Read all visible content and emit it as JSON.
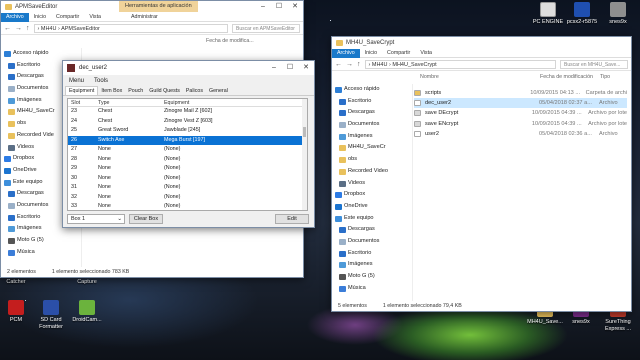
{
  "left_explorer": {
    "title": "APMSaveEditor",
    "context_tab": "Herramientas de aplicación",
    "manage_tab": "Administrar",
    "ribbon": [
      "Archivo",
      "Inicio",
      "Compartir",
      "Vista"
    ],
    "path": [
      "MH4U",
      "APMSaveEditor"
    ],
    "search_placeholder": "Buscar en APMSaveEditor",
    "date_header": "Fecha de modifica...",
    "nav": [
      {
        "label": "Acceso rápido",
        "icon": "star-icon",
        "group": true
      },
      {
        "label": "Escritorio",
        "icon": "desktop-icon"
      },
      {
        "label": "Descargas",
        "icon": "download-icon"
      },
      {
        "label": "Documentos",
        "icon": "documents-icon"
      },
      {
        "label": "Imágenes",
        "icon": "pictures-icon"
      },
      {
        "label": "MH4U_SaveCr",
        "icon": "folder-icon"
      },
      {
        "label": "obs",
        "icon": "folder-icon"
      },
      {
        "label": "Recorded Vide",
        "icon": "folder-icon"
      },
      {
        "label": "Videos",
        "icon": "videos-icon"
      },
      {
        "label": "Dropbox",
        "icon": "dropbox-icon",
        "group": true
      },
      {
        "label": "OneDrive",
        "icon": "onedrive-icon",
        "group": true
      },
      {
        "label": "Este equipo",
        "icon": "pc-icon",
        "group": true
      },
      {
        "label": "Descargas",
        "icon": "download-icon"
      },
      {
        "label": "Documentos",
        "icon": "documents-icon"
      },
      {
        "label": "Escritorio",
        "icon": "desktop-icon"
      },
      {
        "label": "Imágenes",
        "icon": "pictures-icon"
      },
      {
        "label": "Moto G (5)",
        "icon": "phone-icon"
      },
      {
        "label": "Música",
        "icon": "music-icon"
      }
    ],
    "status_count": "2 elementos",
    "status_selected": "1 elemento seleccionado  783 KB"
  },
  "dialog": {
    "title": "dec_user2",
    "menu": [
      "Menu",
      "Tools"
    ],
    "tabs": [
      "Equipment",
      "Item Box",
      "Pouch",
      "Guild Quests",
      "Palicos",
      "General"
    ],
    "active_tab": "Equipment",
    "columns": [
      "Slot",
      "Type",
      "Equipment"
    ],
    "rows": [
      [
        "23",
        "Chest",
        "Zinogre Mail Z [602]"
      ],
      [
        "24",
        "Chest",
        "Zinogre Vest Z [603]"
      ],
      [
        "25",
        "Great Sword",
        "Jawblade [245]"
      ],
      [
        "26",
        "Switch Axe",
        "Mega Burst [197]"
      ],
      [
        "27",
        "None",
        "(None)"
      ],
      [
        "28",
        "None",
        "(None)"
      ],
      [
        "29",
        "None",
        "(None)"
      ],
      [
        "30",
        "None",
        "(None)"
      ],
      [
        "31",
        "None",
        "(None)"
      ],
      [
        "32",
        "None",
        "(None)"
      ],
      [
        "33",
        "None",
        "(None)"
      ]
    ],
    "selected_row": 3,
    "box_select": "Box 1",
    "clear_label": "Clear Box",
    "edit_label": "Edit"
  },
  "right_explorer": {
    "title": "MH4U_SaveCrypt",
    "ribbon": [
      "Archivo",
      "Inicio",
      "Compartir",
      "Vista"
    ],
    "path": [
      "MH4U",
      "MH4U_SaveCrypt"
    ],
    "search_placeholder": "Buscar en MH4U_Save...",
    "columns": [
      "Nombre",
      "Fecha de modificación",
      "Tipo"
    ],
    "files": [
      {
        "name": "scripts",
        "date": "10/09/2015 04:13 ...",
        "type": "Carpeta de archi",
        "icon": "folder-icon"
      },
      {
        "name": "dec_user2",
        "date": "05/04/2018 02:37 a...",
        "type": "Archivo",
        "icon": "file-icon",
        "selected": true
      },
      {
        "name": "save DEcrypt",
        "date": "10/09/2015 04:39 ...",
        "type": "Archivo por lote",
        "icon": "batch-icon"
      },
      {
        "name": "save ENcrypt",
        "date": "10/09/2015 04:39 ...",
        "type": "Archivo por lote",
        "icon": "batch-icon"
      },
      {
        "name": "user2",
        "date": "05/04/2018 02:36 a...",
        "type": "Archivo",
        "icon": "file-icon"
      }
    ],
    "nav": [
      {
        "label": "Acceso rápido",
        "icon": "star-icon",
        "group": true
      },
      {
        "label": "Escritorio",
        "icon": "desktop-icon"
      },
      {
        "label": "Descargas",
        "icon": "download-icon"
      },
      {
        "label": "Documentos",
        "icon": "documents-icon"
      },
      {
        "label": "Imágenes",
        "icon": "pictures-icon"
      },
      {
        "label": "MH4U_SaveCr",
        "icon": "folder-icon"
      },
      {
        "label": "obs",
        "icon": "folder-icon"
      },
      {
        "label": "Recorded Video",
        "icon": "folder-icon"
      },
      {
        "label": "Videos",
        "icon": "videos-icon"
      },
      {
        "label": "Dropbox",
        "icon": "dropbox-icon",
        "group": true
      },
      {
        "label": "OneDrive",
        "icon": "onedrive-icon",
        "group": true
      },
      {
        "label": "Este equipo",
        "icon": "pc-icon",
        "group": true
      },
      {
        "label": "Descargas",
        "icon": "download-icon"
      },
      {
        "label": "Documentos",
        "icon": "documents-icon"
      },
      {
        "label": "Escritorio",
        "icon": "desktop-icon"
      },
      {
        "label": "Imágenes",
        "icon": "pictures-icon"
      },
      {
        "label": "Moto G (5)",
        "icon": "phone-icon"
      },
      {
        "label": "Música",
        "icon": "music-icon"
      }
    ],
    "status_count": "5 elementos",
    "status_selected": "1 elemento seleccionado  79,4 KB"
  },
  "desktop": {
    "top_icons": [
      "PC ENGINE",
      "pcsx2-r5875",
      "snes9x"
    ],
    "left_labels": [
      "Catcher",
      "Capture"
    ],
    "bottom_left": [
      "PCM",
      "SD Card Formatter",
      "DroidCam..."
    ],
    "bottom_right": [
      "MH4U_Save...",
      "snes9x",
      "SureThing Express ..."
    ]
  }
}
